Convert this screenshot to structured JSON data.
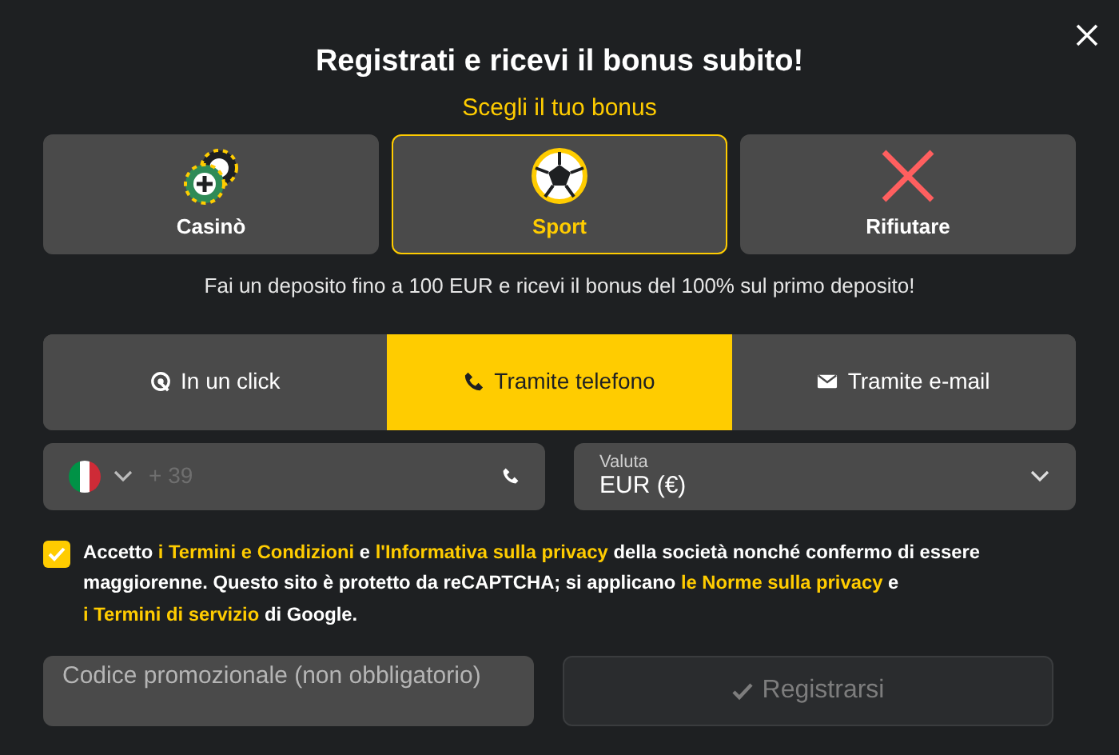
{
  "title": "Registrati e ricevi il bonus subito!",
  "subtitle": "Scegli il tuo bonus",
  "bonuses": [
    {
      "label": "Casinò",
      "kind": "casino",
      "selected": false
    },
    {
      "label": "Sport",
      "kind": "sport",
      "selected": true
    },
    {
      "label": "Rifiutare",
      "kind": "decline",
      "selected": false
    }
  ],
  "bonus_note": "Fai un deposito fino a 100 EUR e ricevi il bonus del 100% sul primo deposito!",
  "methods": [
    {
      "label": "In un click",
      "kind": "click",
      "selected": false
    },
    {
      "label": "Tramite telefono",
      "kind": "phone",
      "selected": true
    },
    {
      "label": "Tramite e-mail",
      "kind": "email",
      "selected": false
    }
  ],
  "phone": {
    "placeholder": "+ 39"
  },
  "currency": {
    "label": "Valuta",
    "value": "EUR (€)"
  },
  "consent": {
    "checked": true,
    "parts": [
      {
        "text": "Accetto ",
        "link": false
      },
      {
        "text": "i Termini e Condizioni",
        "link": true
      },
      {
        "text": " e ",
        "link": false
      },
      {
        "text": "l'Informativa sulla privacy",
        "link": true
      },
      {
        "text": " della società nonché confermo di essere maggiorenne. Questo sito è protetto da reCAPTCHA; si applicano ",
        "link": false
      },
      {
        "text": "le Norme sulla privacy",
        "link": true
      },
      {
        "text": " e ",
        "link": false
      },
      {
        "text": "i Termini di servizio",
        "link": true
      },
      {
        "text": " di Google.",
        "link": false
      }
    ]
  },
  "promo": {
    "placeholder": "Codice promozionale (non obbligatorio)"
  },
  "register": {
    "label": "Registrarsi",
    "disabled": true
  }
}
